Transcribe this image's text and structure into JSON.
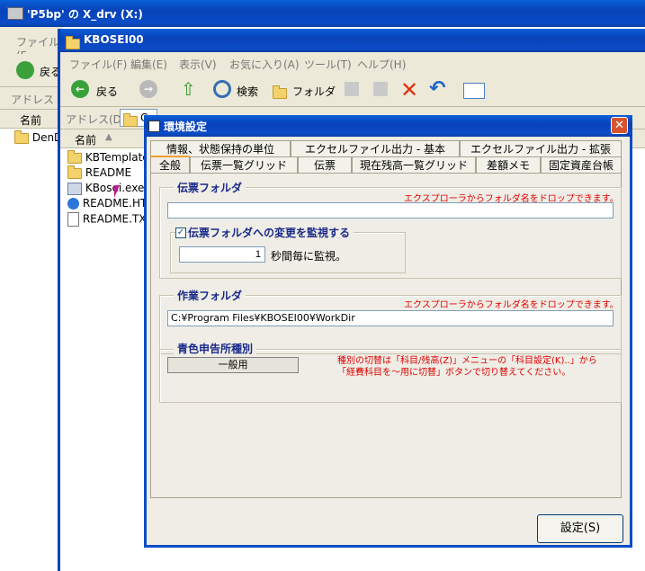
{
  "window1": {
    "title": "'P5bp' の X_drv (X:)",
    "menu_file": "ファイル(F",
    "back_label": "戻る",
    "address_label": "アドレス",
    "col_name": "名前",
    "item": "DenDi"
  },
  "window2": {
    "title": "KBOSEI00",
    "menu": [
      "ファイル(F)",
      "編集(E)",
      "表示(V)",
      "お気に入り(A)",
      "ツール(T)",
      "ヘルプ(H)"
    ],
    "toolbar": {
      "back": "戻る",
      "search": "検索",
      "folder": "フォルダ"
    },
    "address_label": "アドレス(D)",
    "address_value": "C",
    "col_name": "名前",
    "files": [
      {
        "icon": "folder-icon",
        "name": "KBTemplate"
      },
      {
        "icon": "folder-icon",
        "name": "README"
      },
      {
        "icon": "exe-icon",
        "name": "KBosei.exe"
      },
      {
        "icon": "ie-icon",
        "name": "README.HTM"
      },
      {
        "icon": "text-file-icon",
        "name": "README.TXT"
      }
    ]
  },
  "dialog": {
    "title": "環境設定",
    "tabs_row1": [
      "情報、状態保持の単位",
      "エクセルファイル出力 - 基本",
      "エクセルファイル出力 - 拡張"
    ],
    "tabs_row2": [
      "全般",
      "伝票一覧グリッド",
      "伝票",
      "現在残高一覧グリッド",
      "差額メモ",
      "固定資産台帳"
    ],
    "voucher_folder": {
      "label": "伝票フォルダ",
      "hint": "エクスプローラからフォルダ名をドロップできます。",
      "value": "",
      "watch_label": "伝票フォルダへの変更を監視する",
      "watch_checked": true,
      "interval": "1",
      "interval_suffix": "秒間毎に監視。"
    },
    "work_folder": {
      "label": "作業フォルダ",
      "hint": "エクスプローラからフォルダ名をドロップできます。",
      "value": "C:¥Program Files¥KBOSEI00¥WorkDir"
    },
    "blue_return": {
      "label": "青色申告所種別",
      "value": "一般用",
      "note_line1": "種別の切替は「科目/残高(Z)」メニューの「科目設定(K)..」から",
      "note_line2": "「経費科目を〜用に切替」ボタンで切り替えてください。"
    },
    "ok_button": "設定(S)"
  },
  "colors": {
    "title_blue": "#0a4cc7",
    "dialog_bg": "#efede5",
    "accent_red": "#e00000",
    "label_blue": "#1a2a8a"
  }
}
